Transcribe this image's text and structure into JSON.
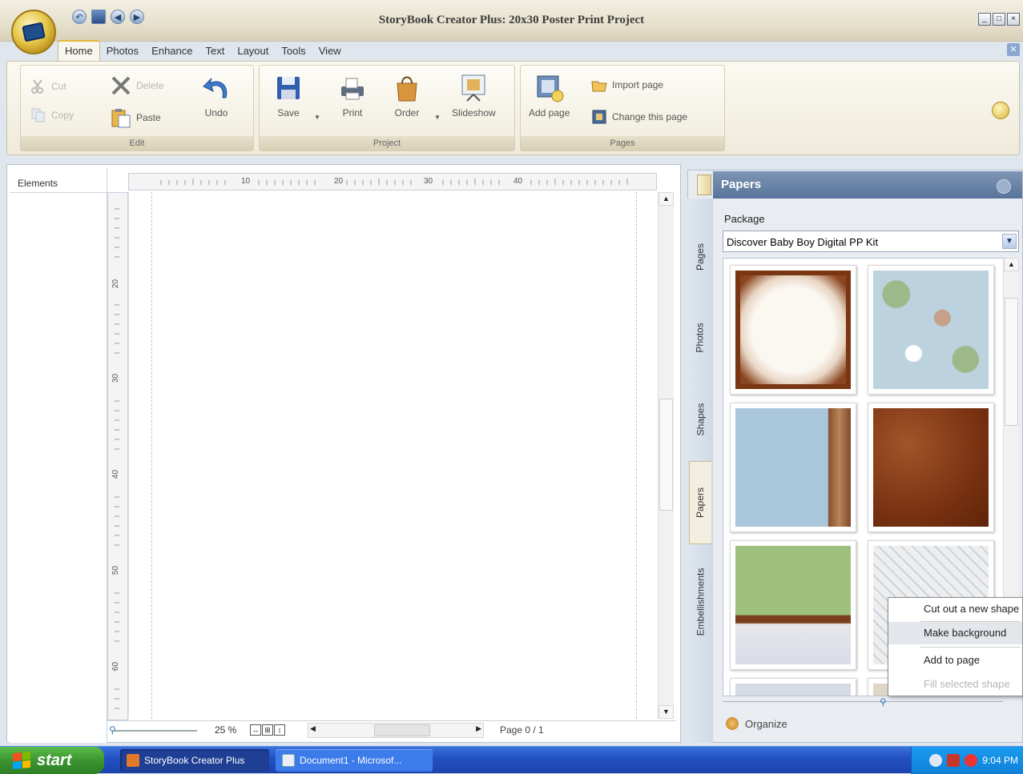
{
  "window": {
    "title": "StoryBook Creator Plus: 20x30 Poster Print Project"
  },
  "ribbon": {
    "tabs": [
      "Home",
      "Photos",
      "Enhance",
      "Text",
      "Layout",
      "Tools",
      "View"
    ],
    "active_tab": "Home",
    "groups": {
      "edit": {
        "label": "Edit",
        "cut": "Cut",
        "copy": "Copy",
        "delete": "Delete",
        "paste": "Paste",
        "undo": "Undo"
      },
      "project": {
        "label": "Project",
        "save": "Save",
        "print": "Print",
        "order": "Order",
        "slideshow": "Slideshow"
      },
      "pages": {
        "label": "Pages",
        "add_page": "Add page",
        "import_page": "Import page",
        "change_page": "Change this page"
      }
    }
  },
  "elements_panel": {
    "title": "Elements"
  },
  "ruler": {
    "horizontal": [
      "10",
      "20",
      "30",
      "40"
    ],
    "vertical": [
      "20",
      "30",
      "40",
      "50",
      "60"
    ]
  },
  "status": {
    "zoom": "25 %",
    "page": "Page 0 / 1"
  },
  "right_panel": {
    "title": "Papers",
    "side_tabs": [
      "Pages",
      "Photos",
      "Shapes",
      "Papers",
      "Embellishments"
    ],
    "active_side_tab": "Papers",
    "package_label": "Package",
    "package_value": "Discover Baby Boy Digital PP Kit",
    "organize": "Organize"
  },
  "context_menu": {
    "items": [
      {
        "label": "Cut out a new shape",
        "state": "normal"
      },
      {
        "label": "Make background",
        "state": "highlighted"
      },
      {
        "label": "Add to page",
        "state": "normal"
      },
      {
        "label": "Fill selected shape",
        "state": "disabled"
      }
    ]
  },
  "taskbar": {
    "start": "start",
    "tasks": [
      "StoryBook Creator Plus",
      "Document1 - Microsof..."
    ],
    "clock": "9:04 PM"
  },
  "colors": {
    "accent": "#58739a",
    "taskbar": "#2452c4",
    "start": "#3b9530"
  }
}
